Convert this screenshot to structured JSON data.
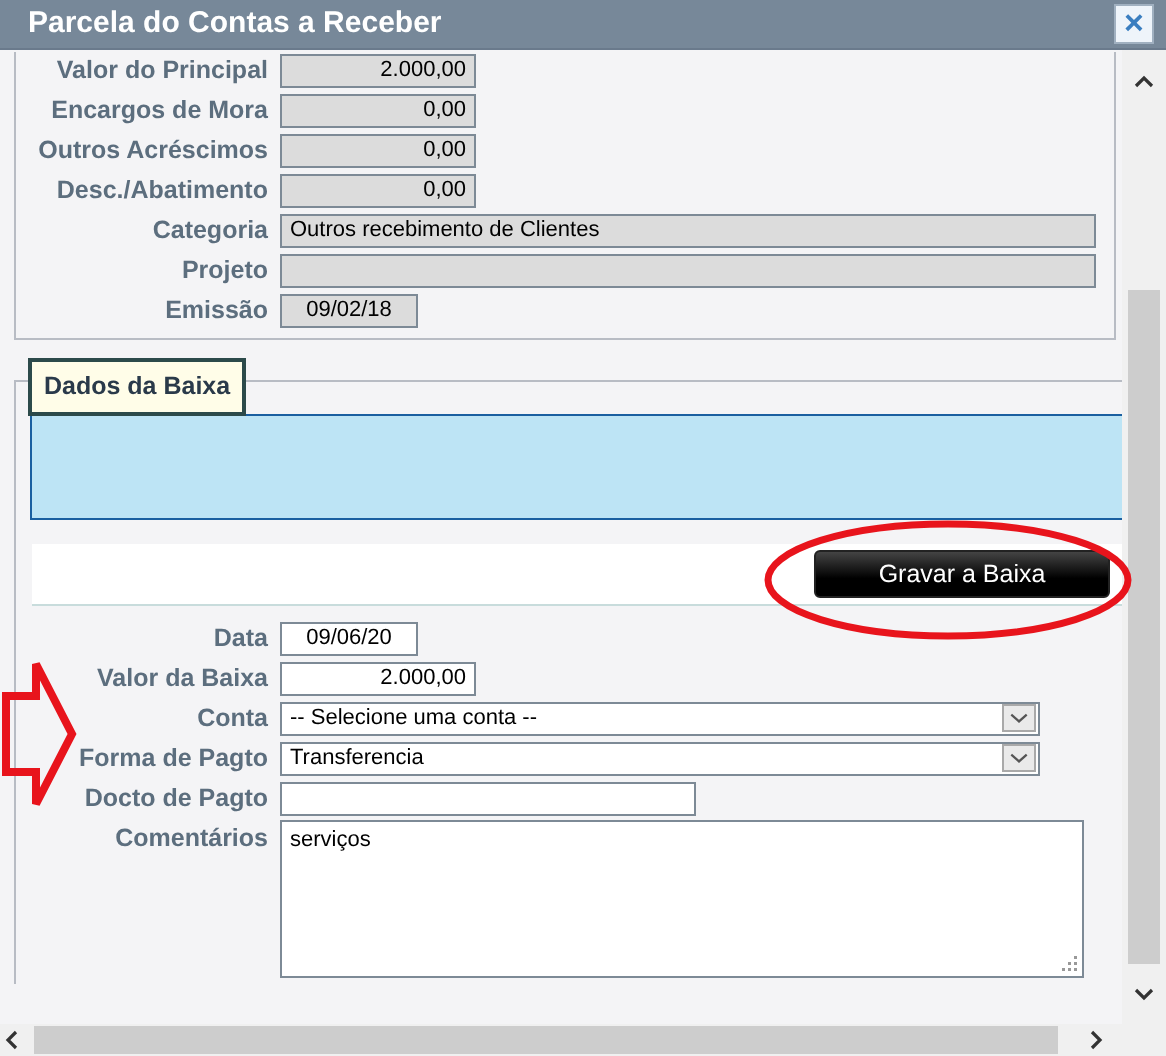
{
  "window": {
    "title": "Parcela do Contas a Receber",
    "close": "×"
  },
  "principal": [
    {
      "label": "Valor do Principal",
      "value": "2.000,00",
      "kind": "number",
      "readonly": true
    },
    {
      "label": "Encargos de Mora",
      "value": "0,00",
      "kind": "number",
      "readonly": true
    },
    {
      "label": "Outros Acréscimos",
      "value": "0,00",
      "kind": "number",
      "readonly": true
    },
    {
      "label": "Desc./Abatimento",
      "value": "0,00",
      "kind": "number",
      "readonly": true
    },
    {
      "label": "Categoria",
      "value": "Outros recebimento de Clientes",
      "kind": "wide",
      "readonly": true
    },
    {
      "label": "Projeto",
      "kind": "wide",
      "readonly": true
    },
    {
      "label": "Emissão",
      "value": "09/02/18",
      "kind": "date",
      "readonly": true
    }
  ],
  "baixa": {
    "legend": "Dados da Baixa",
    "button": "Gravar a Baixa",
    "fields": [
      {
        "label": "Data",
        "value": "09/06/20",
        "kind": "date",
        "readonly": false
      },
      {
        "label": "Valor da Baixa",
        "value": "2.000,00",
        "kind": "number",
        "readonly": false
      },
      {
        "label": "Conta",
        "value": "-- Selecione uma conta --",
        "kind": "select",
        "readonly": false
      },
      {
        "label": "Forma de Pagto",
        "value": "Transferencia",
        "kind": "select",
        "readonly": false
      },
      {
        "label": "Docto de Pagto",
        "kind": "text",
        "readonly": false
      },
      {
        "label": "Comentários",
        "value": "serviços",
        "kind": "textarea",
        "readonly": false
      }
    ]
  }
}
